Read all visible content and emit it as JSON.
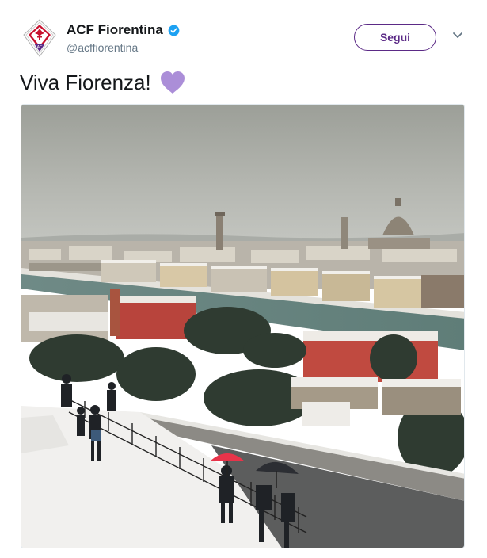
{
  "account": {
    "name": "ACF Fiorentina",
    "handle": "@acffiorentina",
    "verified": true,
    "avatar_icon": "fiorentina-crest-icon"
  },
  "follow_button": {
    "label": "Segui"
  },
  "menu": {
    "icon": "chevron-down-icon"
  },
  "tweet": {
    "text": "Viva Fiorenza!",
    "emoji": "purple-heart-icon"
  },
  "media": {
    "type": "photo",
    "subject": "snowy panorama of Florence"
  },
  "colors": {
    "brand_purple": "#5b2a86",
    "verified_blue": "#1da1f2",
    "heart_purple": "#ab8ed8",
    "handle_gray": "#657786"
  }
}
